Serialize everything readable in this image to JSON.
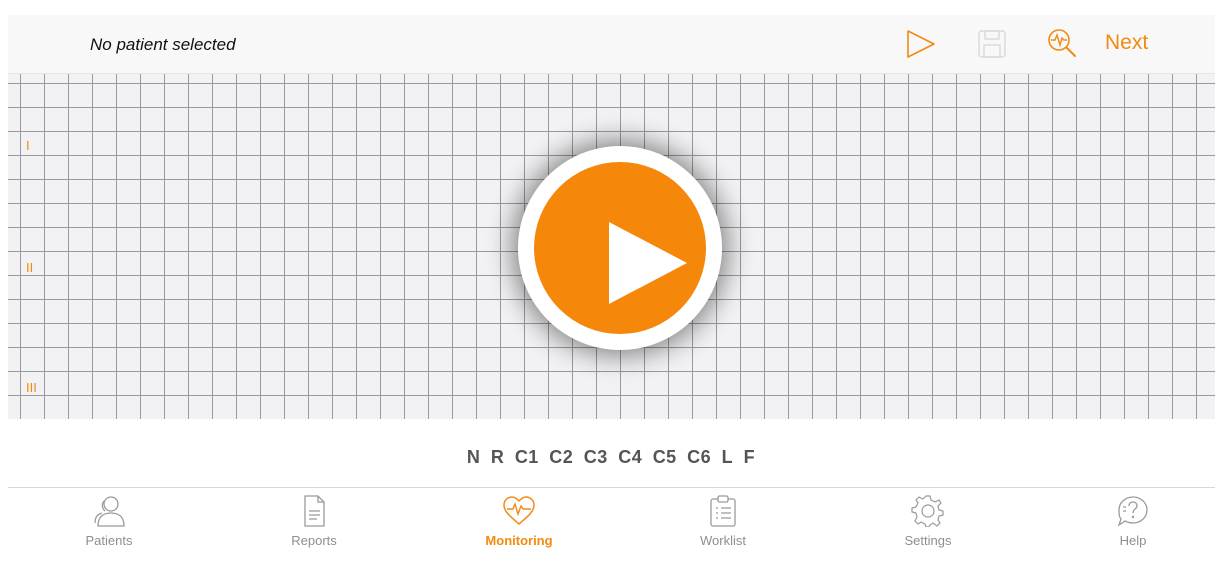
{
  "header": {
    "patient_title": "No patient selected",
    "next_label": "Next",
    "icons": [
      "play-outline-icon",
      "save-icon",
      "magnifier-ecg-icon"
    ],
    "accent_color": "#f28a12"
  },
  "monitor": {
    "lead_labels": [
      "I",
      "II",
      "III"
    ],
    "play_icon": "play-button-icon"
  },
  "leads": [
    "N",
    "R",
    "C1",
    "C2",
    "C3",
    "C4",
    "C5",
    "C6",
    "L",
    "F"
  ],
  "tabs": [
    {
      "label": "Patients",
      "icon": "patients-icon",
      "active": false
    },
    {
      "label": "Reports",
      "icon": "document-icon",
      "active": false
    },
    {
      "label": "Monitoring",
      "icon": "heart-ecg-icon",
      "active": true
    },
    {
      "label": "Worklist",
      "icon": "clipboard-icon",
      "active": false
    },
    {
      "label": "Settings",
      "icon": "gear-icon",
      "active": false
    },
    {
      "label": "Help",
      "icon": "help-bubble-icon",
      "active": false
    }
  ]
}
